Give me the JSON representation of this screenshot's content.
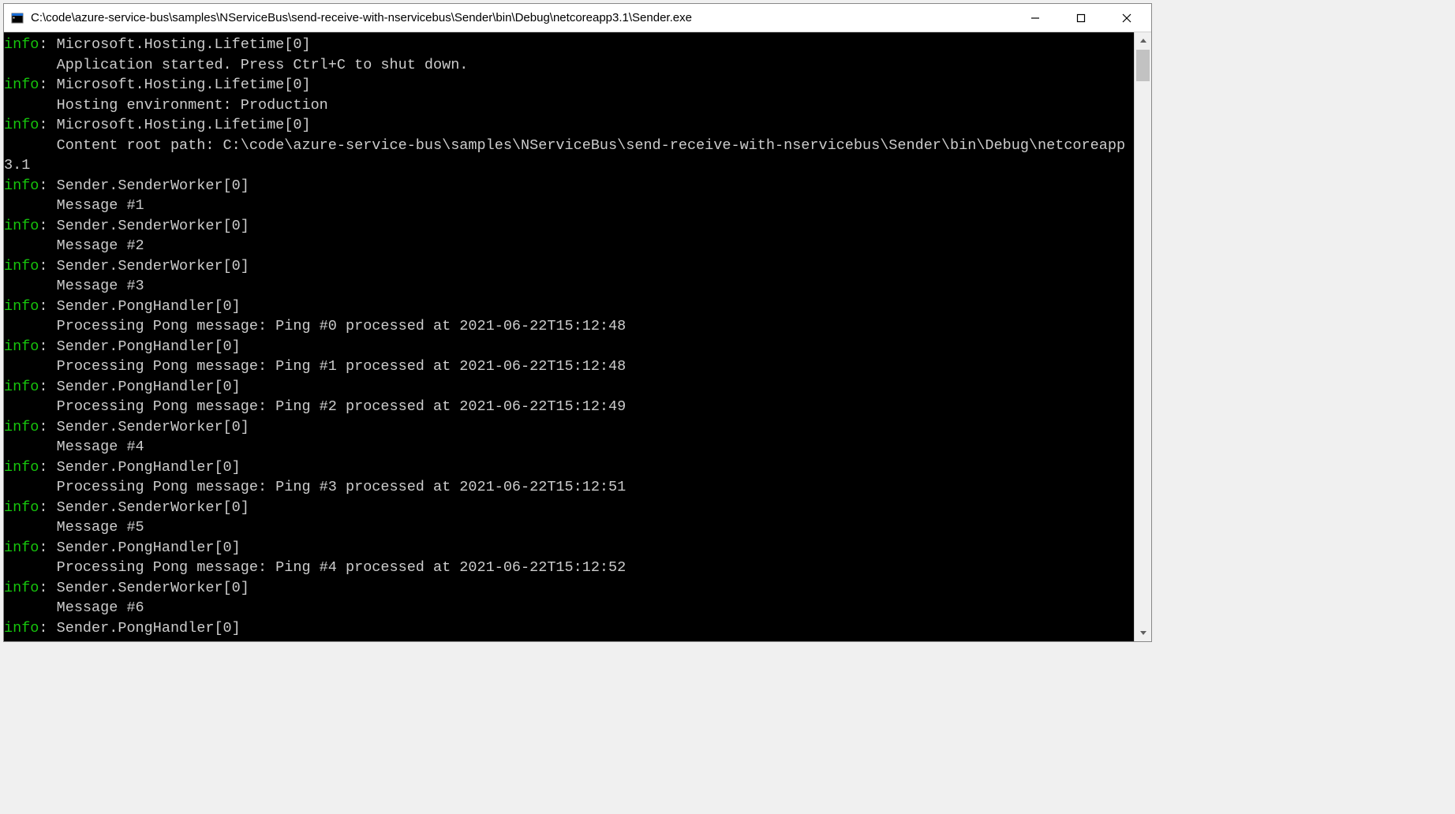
{
  "window": {
    "title": "C:\\code\\azure-service-bus\\samples\\NServiceBus\\send-receive-with-nservicebus\\Sender\\bin\\Debug\\netcoreapp3.1\\Sender.exe"
  },
  "console": {
    "lines": [
      {
        "level": "info",
        "source": "Microsoft.Hosting.Lifetime[0]",
        "body": "      Application started. Press Ctrl+C to shut down."
      },
      {
        "level": "info",
        "source": "Microsoft.Hosting.Lifetime[0]",
        "body": "      Hosting environment: Production"
      },
      {
        "level": "info",
        "source": "Microsoft.Hosting.Lifetime[0]",
        "body": "      Content root path: C:\\code\\azure-service-bus\\samples\\NServiceBus\\send-receive-with-nservicebus\\Sender\\bin\\Debug\\netcoreapp3.1"
      },
      {
        "level": "info",
        "source": "Sender.SenderWorker[0]",
        "body": "      Message #1"
      },
      {
        "level": "info",
        "source": "Sender.SenderWorker[0]",
        "body": "      Message #2"
      },
      {
        "level": "info",
        "source": "Sender.SenderWorker[0]",
        "body": "      Message #3"
      },
      {
        "level": "info",
        "source": "Sender.PongHandler[0]",
        "body": "      Processing Pong message: Ping #0 processed at 2021-06-22T15:12:48"
      },
      {
        "level": "info",
        "source": "Sender.PongHandler[0]",
        "body": "      Processing Pong message: Ping #1 processed at 2021-06-22T15:12:48"
      },
      {
        "level": "info",
        "source": "Sender.PongHandler[0]",
        "body": "      Processing Pong message: Ping #2 processed at 2021-06-22T15:12:49"
      },
      {
        "level": "info",
        "source": "Sender.SenderWorker[0]",
        "body": "      Message #4"
      },
      {
        "level": "info",
        "source": "Sender.PongHandler[0]",
        "body": "      Processing Pong message: Ping #3 processed at 2021-06-22T15:12:51"
      },
      {
        "level": "info",
        "source": "Sender.SenderWorker[0]",
        "body": "      Message #5"
      },
      {
        "level": "info",
        "source": "Sender.PongHandler[0]",
        "body": "      Processing Pong message: Ping #4 processed at 2021-06-22T15:12:52"
      },
      {
        "level": "info",
        "source": "Sender.SenderWorker[0]",
        "body": "      Message #6"
      },
      {
        "level": "info",
        "source": "Sender.PongHandler[0]",
        "body": ""
      }
    ]
  }
}
